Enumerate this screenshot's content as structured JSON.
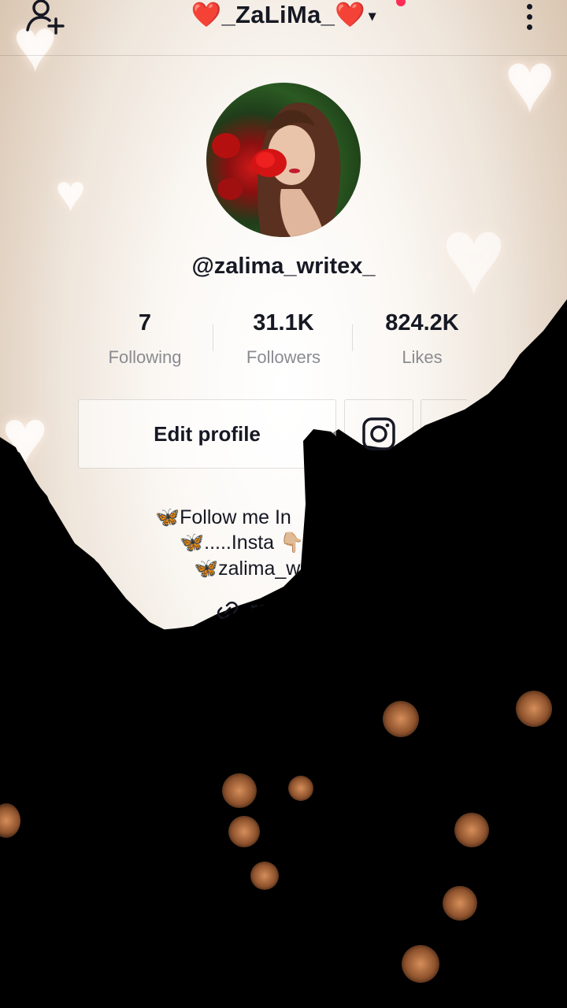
{
  "header": {
    "title": "❤️_ZaLiMa_❤️",
    "caret": "▾"
  },
  "profile": {
    "handle": "@zalima_writex_"
  },
  "stats": [
    {
      "value": "7",
      "label": "Following"
    },
    {
      "value": "31.1K",
      "label": "Followers"
    },
    {
      "value": "824.2K",
      "label": "Likes"
    }
  ],
  "actions": {
    "edit_profile": "Edit profile"
  },
  "bio": {
    "line1": "🦋Follow me In",
    "line2": "🦋.....Insta 👇🏼",
    "line3": "🦋zalima_w",
    "link": "ropo"
  },
  "colors": {
    "text": "#161823",
    "muted": "#8a8b91",
    "notification_dot": "#fe2c55"
  }
}
